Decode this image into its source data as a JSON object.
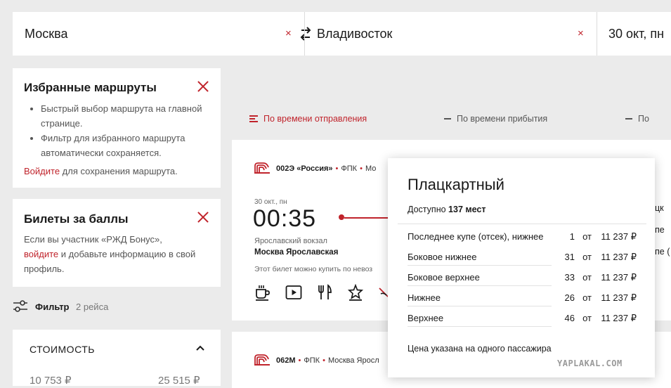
{
  "search": {
    "from": "Москва",
    "to": "Владивосток",
    "date": "30 окт, пн",
    "clear_symbol": "×"
  },
  "favorites": {
    "title": "Избранные маршруты",
    "bullets": [
      "Быстрый выбор маршрута на главной странице.",
      "Фильтр для избранного маршрута автоматически сохраняется."
    ],
    "login_link": "Войдите",
    "login_suffix": " для сохранения маршрута."
  },
  "points": {
    "title": "Билеты за баллы",
    "text_pre": "Если вы участник «РЖД Бонус»,",
    "login_link": "войдите",
    "text_post": " и добавьте информацию в свой профиль."
  },
  "filter": {
    "label": "Фильтр",
    "count": "2 рейса"
  },
  "price_filter": {
    "title": "СТОИМОСТЬ",
    "min": "10 753 ₽",
    "max": "25 515 ₽"
  },
  "sort": {
    "departure": "По времени отправления",
    "arrival": "По времени прибытия",
    "third": "По"
  },
  "train1": {
    "number": "002Э",
    "name": "«Россия»",
    "carrier": "ФПК",
    "route_partial": "Мо",
    "date": "30 окт., пн",
    "time": "00:35",
    "station": "Ярославский вокзал",
    "station_bold": "Москва Ярославская",
    "note": "Этот билет можно купить по невоз",
    "right_edge": [
      "цк",
      "пе",
      "пе ("
    ]
  },
  "train2": {
    "number": "062М",
    "carrier": "ФПК",
    "route_partial": "Москва Яросл"
  },
  "popup": {
    "title": "Плацкартный",
    "avail_pre": "Доступно",
    "avail_count": "137 мест",
    "rows": [
      {
        "name": "Последнее купе (отсек), нижнее",
        "count": "1",
        "from": "от",
        "price": "11 237 ₽"
      },
      {
        "name": "Боковое нижнее",
        "count": "31",
        "from": "от",
        "price": "11 237 ₽"
      },
      {
        "name": "Боковое верхнее",
        "count": "33",
        "from": "от",
        "price": "11 237 ₽"
      },
      {
        "name": "Нижнее",
        "count": "26",
        "from": "от",
        "price": "11 237 ₽"
      },
      {
        "name": "Верхнее",
        "count": "46",
        "from": "от",
        "price": "11 237 ₽"
      }
    ],
    "note": "Цена указана на одного пассажира"
  },
  "watermark": "YAPLAKAL.COM",
  "colors": {
    "accent": "#c0232b",
    "background": "#ebebeb",
    "card": "#ffffff"
  },
  "icons": [
    "swap-icon",
    "close-icon",
    "filter-sliders-icon",
    "chevron-up-icon",
    "rzd-logo-icon",
    "cup-icon",
    "video-icon",
    "food-icon",
    "star-icon",
    "no-pets-icon",
    "sort-lines-icon",
    "minus-icon"
  ]
}
